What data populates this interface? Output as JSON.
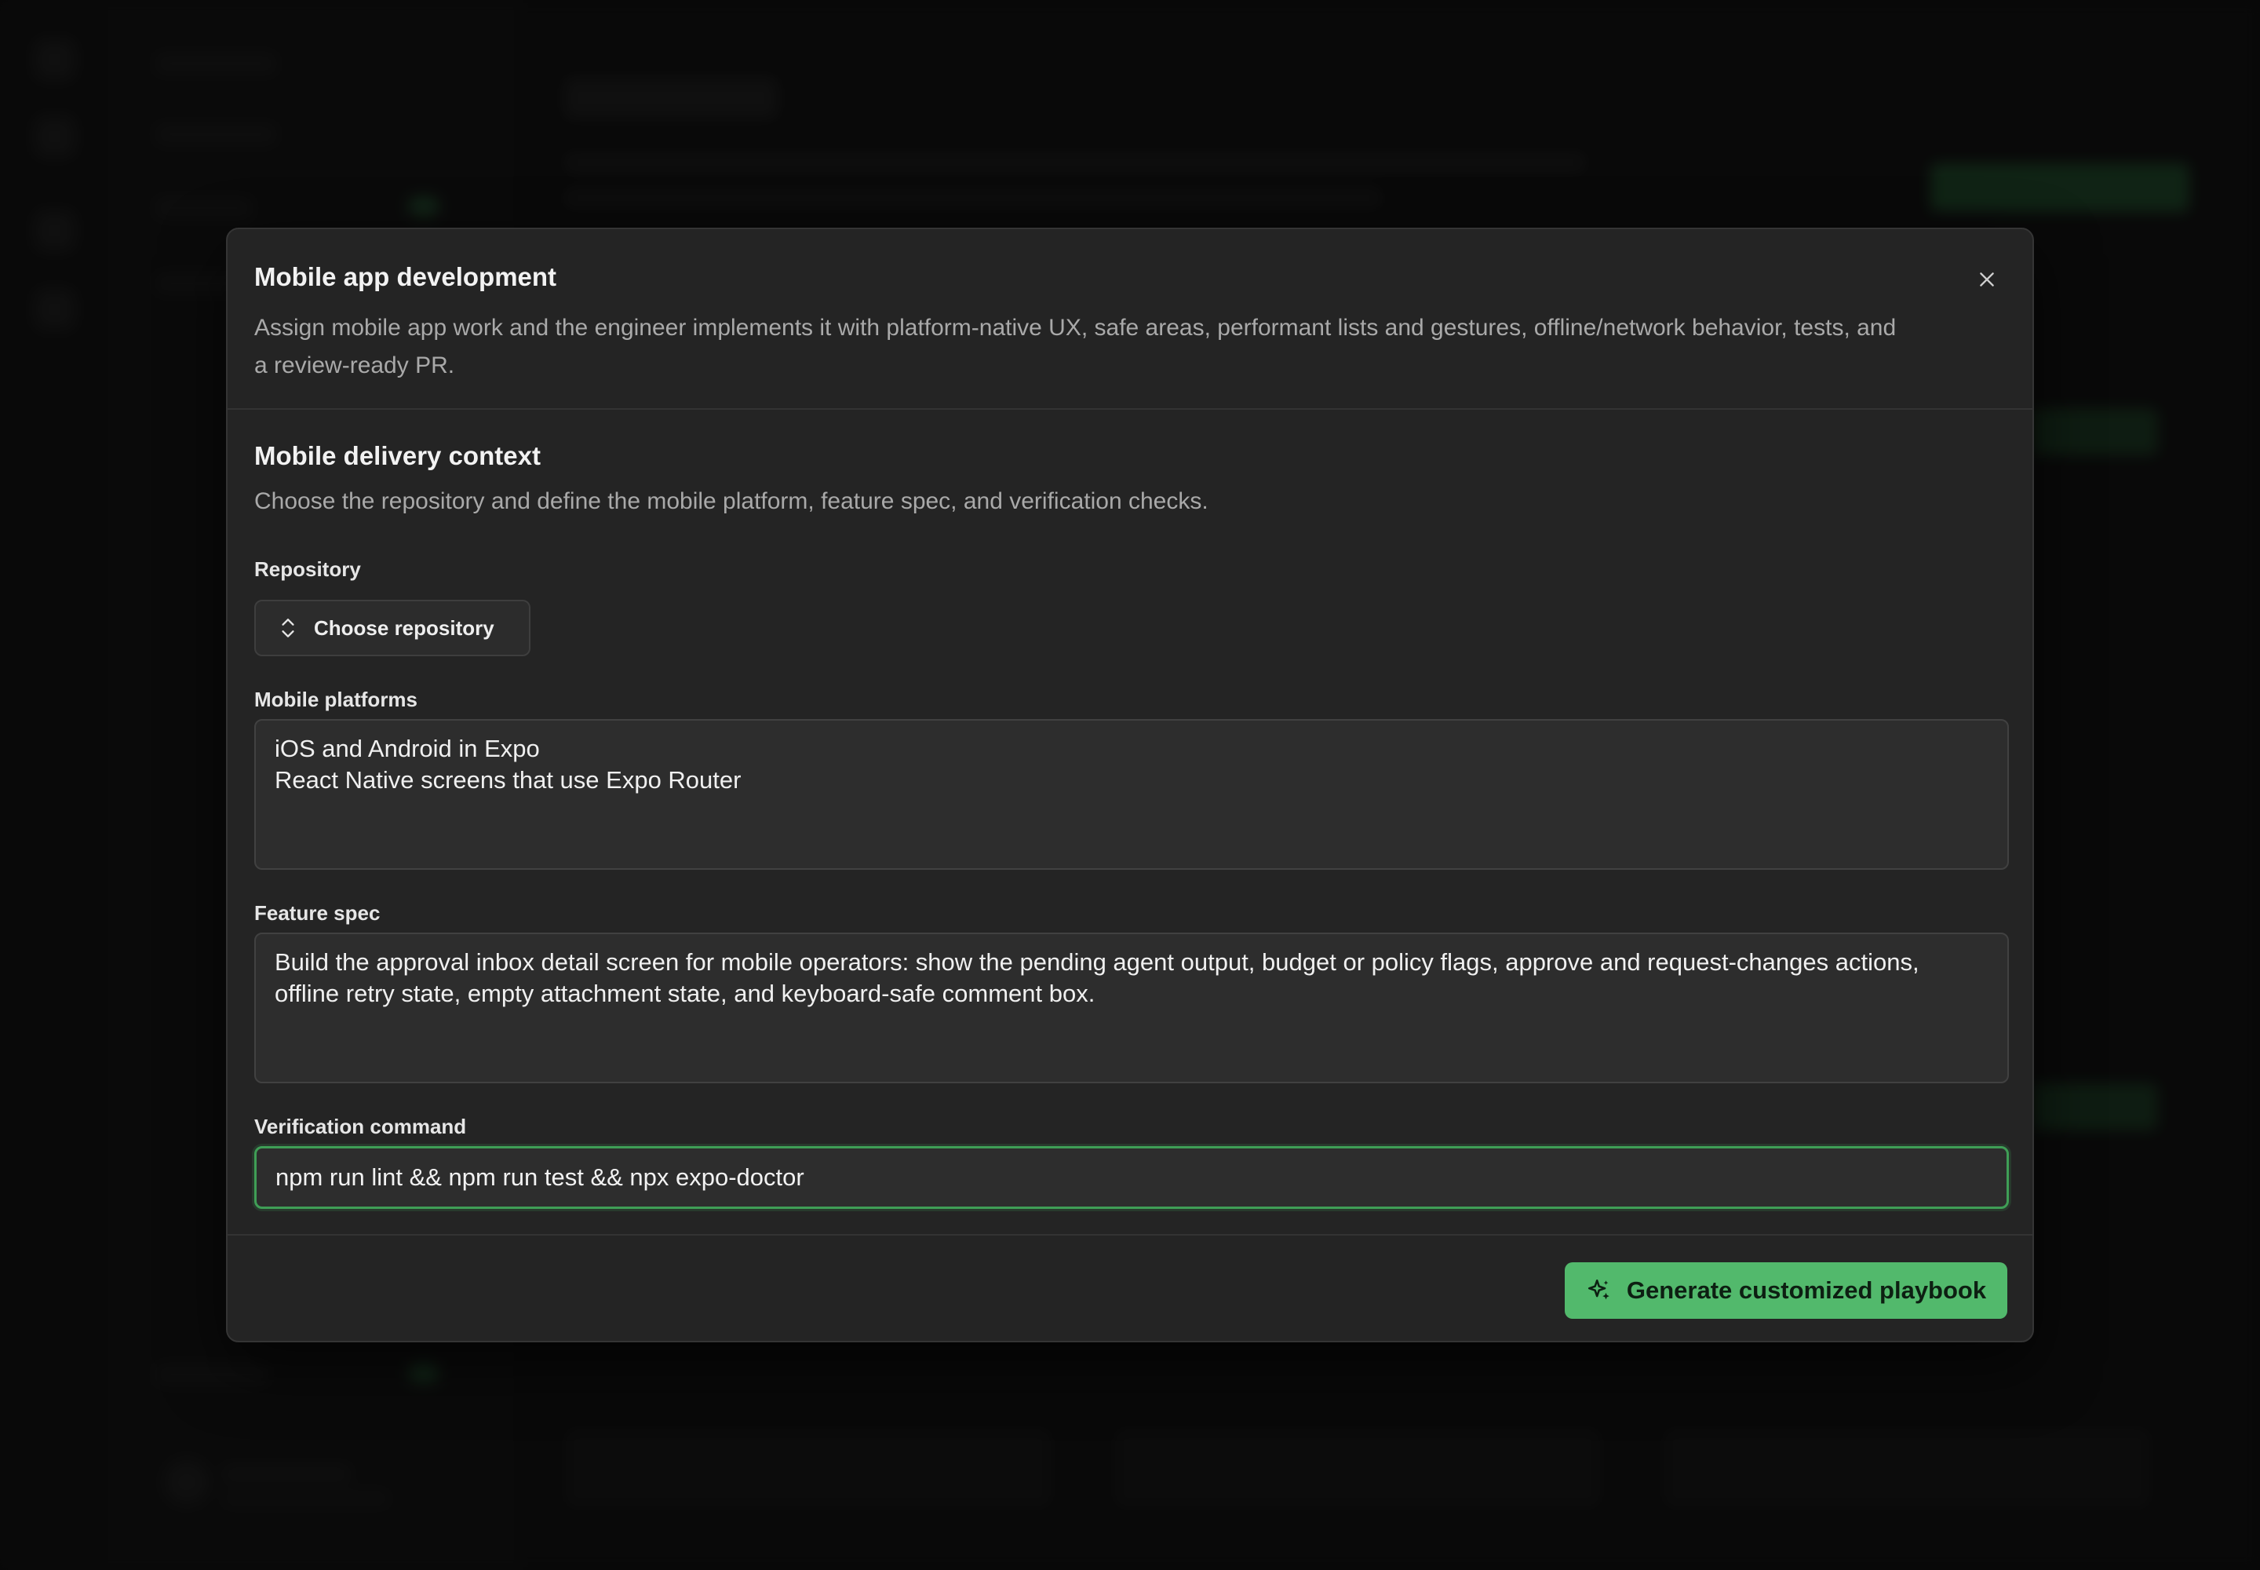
{
  "modal": {
    "title": "Mobile app development",
    "description": "Assign mobile app work and the engineer implements it with platform-native UX, safe areas, performant lists and gestures, offline/network behavior, tests, and a review-ready PR.",
    "close_icon": "close-icon"
  },
  "section": {
    "title": "Mobile delivery context",
    "description": "Choose the repository and define the mobile platform, feature spec, and verification checks."
  },
  "repository": {
    "label": "Repository",
    "button_label": "Choose repository",
    "icon": "chevron-up-down-icon"
  },
  "mobile_platforms": {
    "label": "Mobile platforms",
    "value": "iOS and Android in Expo\nReact Native screens that use Expo Router"
  },
  "feature_spec": {
    "label": "Feature spec",
    "value": "Build the approval inbox detail screen for mobile operators: show the pending agent output, budget or policy flags, approve and request-changes actions, offline retry state, empty attachment state, and keyboard-safe comment box."
  },
  "verification": {
    "label": "Verification command",
    "value": "npm run lint && npm run test && npx expo-doctor"
  },
  "footer": {
    "generate_label": "Generate customized playbook",
    "generate_icon": "sparkles-icon"
  },
  "colors": {
    "accent": "#52b96c",
    "focus_border": "#3f9e56",
    "modal_bg": "#242424"
  }
}
